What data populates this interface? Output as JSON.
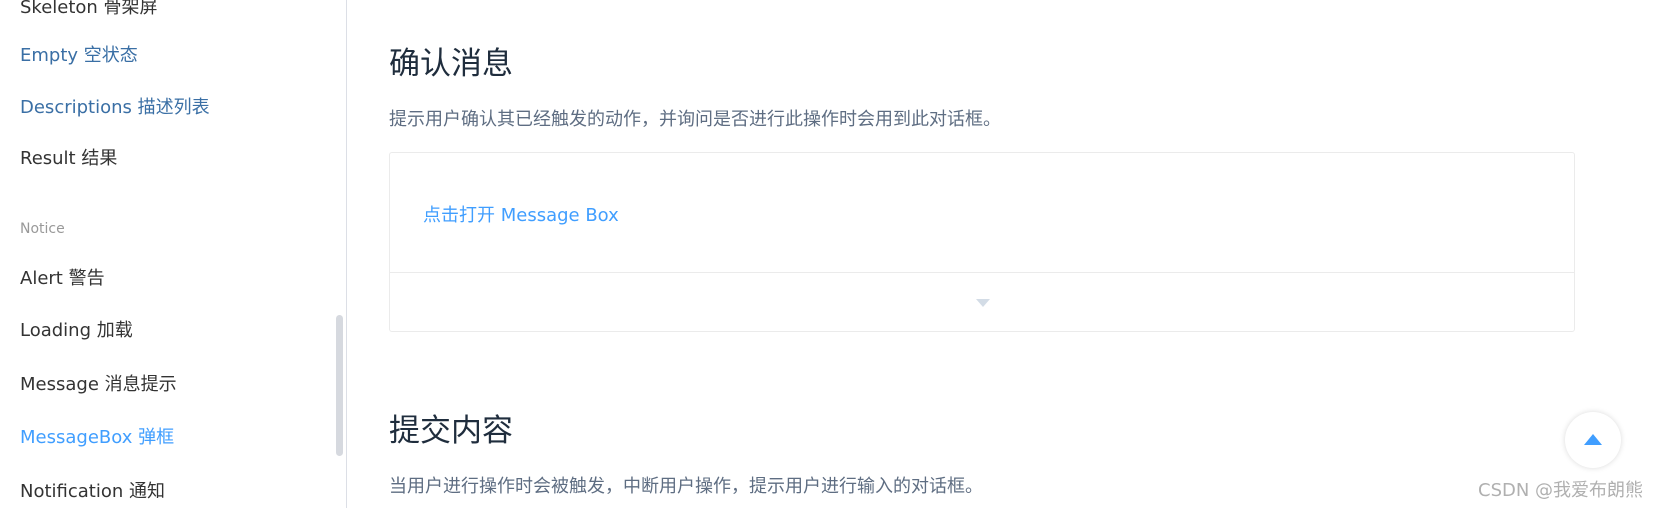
{
  "sidebar": {
    "items": [
      {
        "label": "Skeleton 骨架屏",
        "state": "normal"
      },
      {
        "label": "Empty 空状态",
        "state": "link"
      },
      {
        "label": "Descriptions 描述列表",
        "state": "link"
      },
      {
        "label": "Result 结果",
        "state": "normal"
      },
      {
        "label": "Notice",
        "state": "group"
      },
      {
        "label": "Alert 警告",
        "state": "normal"
      },
      {
        "label": "Loading 加载",
        "state": "normal"
      },
      {
        "label": "Message 消息提示",
        "state": "normal"
      },
      {
        "label": "MessageBox 弹框",
        "state": "active"
      },
      {
        "label": "Notification 通知",
        "state": "normal"
      }
    ]
  },
  "main": {
    "section1": {
      "title": "确认消息",
      "description": "提示用户确认其已经触发的动作，并询问是否进行此操作时会用到此对话框。",
      "demo_link": "点击打开 Message Box",
      "expand_icon": "caret-down-icon"
    },
    "section2": {
      "title": "提交内容",
      "description": "当用户进行操作时会被触发，中断用户操作，提示用户进行输入的对话框。"
    }
  },
  "backtop": {
    "icon": "caret-up-icon"
  },
  "watermark": "CSDN @我爱布朗熊",
  "colors": {
    "accent": "#409eff",
    "link": "#3a6fa5",
    "text": "#333333",
    "heading": "#1f2d3d",
    "description": "#5e6d82"
  }
}
